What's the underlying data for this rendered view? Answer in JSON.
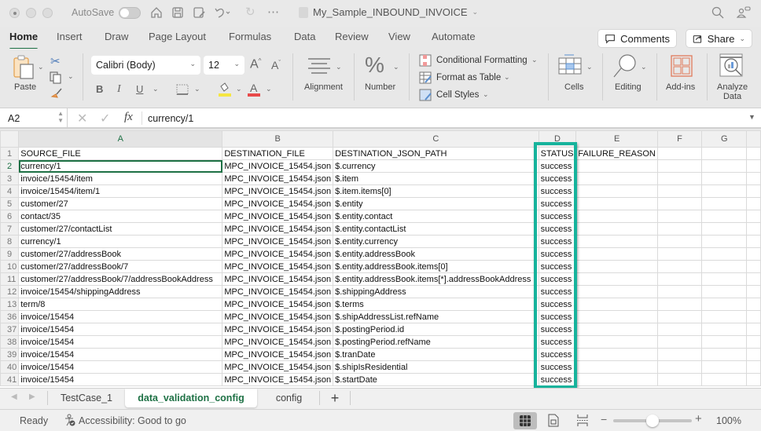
{
  "titlebar": {
    "autosave_label": "AutoSave",
    "autosave_on": false,
    "document_title": "My_Sample_INBOUND_INVOICE",
    "icons": [
      "home-icon",
      "save-icon",
      "save-as-icon",
      "undo-icon",
      "redo-icon",
      "more-icon",
      "search-icon",
      "share-people-icon"
    ]
  },
  "menu_tabs": [
    "Home",
    "Insert",
    "Draw",
    "Page Layout",
    "Formulas",
    "Data",
    "Review",
    "View",
    "Automate"
  ],
  "active_tab": "Home",
  "comments_label": "Comments",
  "share_label": "Share",
  "ribbon": {
    "paste_label": "Paste",
    "font_name": "Calibri (Body)",
    "font_size": "12",
    "alignment_label": "Alignment",
    "number_label": "Number",
    "conditional_formatting": "Conditional Formatting",
    "format_as_table": "Format as Table",
    "cell_styles": "Cell Styles",
    "cells_label": "Cells",
    "editing_label": "Editing",
    "addins_label": "Add-ins",
    "analyze_label_1": "Analyze",
    "analyze_label_2": "Data",
    "fill_color": "#f5e642",
    "font_color": "#e84a4a"
  },
  "formula_bar": {
    "name_box": "A2",
    "fx": "fx",
    "value": "currency/1"
  },
  "columns": [
    "A",
    "B",
    "C",
    "D",
    "E",
    "F",
    "G"
  ],
  "selected_column": "A",
  "header_row": {
    "row": "1",
    "cells": [
      "SOURCE_FILE",
      "DESTINATION_FILE",
      "DESTINATION_JSON_PATH",
      "STATUS",
      "FAILURE_REASON",
      "",
      ""
    ]
  },
  "rows": [
    {
      "row": "2",
      "cells": [
        "currency/1",
        "MPC_INVOICE_15454.json",
        "$.currency",
        "success",
        "",
        "",
        ""
      ]
    },
    {
      "row": "3",
      "cells": [
        "invoice/15454/item",
        "MPC_INVOICE_15454.json",
        "$.item",
        "success",
        "",
        "",
        ""
      ]
    },
    {
      "row": "4",
      "cells": [
        "invoice/15454/item/1",
        "MPC_INVOICE_15454.json",
        "$.item.items[0]",
        "success",
        "",
        "",
        ""
      ]
    },
    {
      "row": "5",
      "cells": [
        "customer/27",
        "MPC_INVOICE_15454.json",
        "$.entity",
        "success",
        "",
        "",
        ""
      ]
    },
    {
      "row": "6",
      "cells": [
        "contact/35",
        "MPC_INVOICE_15454.json",
        "$.entity.contact",
        "success",
        "",
        "",
        ""
      ]
    },
    {
      "row": "7",
      "cells": [
        "customer/27/contactList",
        "MPC_INVOICE_15454.json",
        "$.entity.contactList",
        "success",
        "",
        "",
        ""
      ]
    },
    {
      "row": "8",
      "cells": [
        "currency/1",
        "MPC_INVOICE_15454.json",
        "$.entity.currency",
        "success",
        "",
        "",
        ""
      ]
    },
    {
      "row": "9",
      "cells": [
        "customer/27/addressBook",
        "MPC_INVOICE_15454.json",
        "$.entity.addressBook",
        "success",
        "",
        "",
        ""
      ]
    },
    {
      "row": "10",
      "cells": [
        "customer/27/addressBook/7",
        "MPC_INVOICE_15454.json",
        "$.entity.addressBook.items[0]",
        "success",
        "",
        "",
        ""
      ]
    },
    {
      "row": "11",
      "cells": [
        "customer/27/addressBook/7/addressBookAddress",
        "MPC_INVOICE_15454.json",
        "$.entity.addressBook.items[*].addressBookAddress",
        "success",
        "",
        "",
        ""
      ]
    },
    {
      "row": "12",
      "cells": [
        "invoice/15454/shippingAddress",
        "MPC_INVOICE_15454.json",
        "$.shippingAddress",
        "success",
        "",
        "",
        ""
      ]
    },
    {
      "row": "13",
      "cells": [
        "term/8",
        "MPC_INVOICE_15454.json",
        "$.terms",
        "success",
        "",
        "",
        ""
      ]
    },
    {
      "row": "36",
      "cells": [
        "invoice/15454",
        "MPC_INVOICE_15454.json",
        "$.shipAddressList.refName",
        "success",
        "",
        "",
        ""
      ]
    },
    {
      "row": "37",
      "cells": [
        "invoice/15454",
        "MPC_INVOICE_15454.json",
        "$.postingPeriod.id",
        "success",
        "",
        "",
        ""
      ]
    },
    {
      "row": "38",
      "cells": [
        "invoice/15454",
        "MPC_INVOICE_15454.json",
        "$.postingPeriod.refName",
        "success",
        "",
        "",
        ""
      ]
    },
    {
      "row": "39",
      "cells": [
        "invoice/15454",
        "MPC_INVOICE_15454.json",
        "$.tranDate",
        "success",
        "",
        "",
        ""
      ]
    },
    {
      "row": "40",
      "cells": [
        "invoice/15454",
        "MPC_INVOICE_15454.json",
        "$.shipIsResidential",
        "success",
        "",
        "",
        ""
      ]
    },
    {
      "row": "41",
      "cells": [
        "invoice/15454",
        "MPC_INVOICE_15454.json",
        "$.startDate",
        "success",
        "",
        "",
        ""
      ]
    }
  ],
  "selected_row": "2",
  "highlight_color": "#16b39c",
  "sheet_tabs": [
    "TestCase_1",
    "data_validation_config",
    "config"
  ],
  "active_sheet": "data_validation_config",
  "add_sheet": "+",
  "status": {
    "ready": "Ready",
    "accessibility": "Accessibility: Good to go",
    "zoom_level": "100%",
    "zoom_fraction": 0.5,
    "minus": "−",
    "plus": "+"
  }
}
